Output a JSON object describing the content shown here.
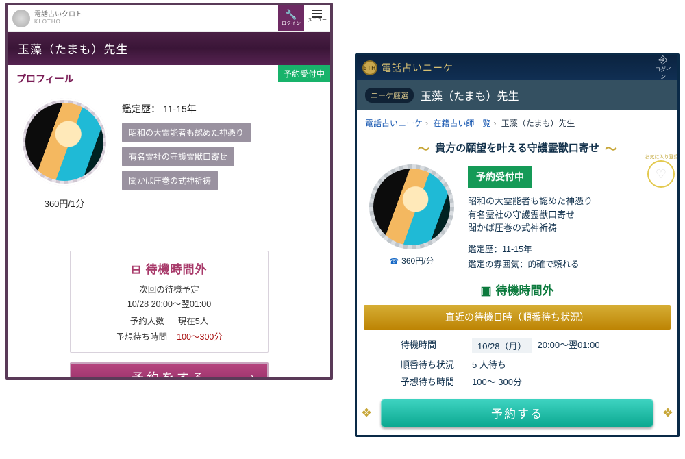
{
  "klotho": {
    "brand_top": "電話占いクロト",
    "brand_sub": "KLOTHO",
    "login_label": "ログイン",
    "menu_label": "メニュー",
    "title": "玉藻（たまも）先生",
    "section_title": "プロフィール",
    "status_badge": "予約受付中",
    "experience_label": "鑑定歴",
    "experience_value": "11-15年",
    "tags": [
      "昭和の大霊能者も認めた神憑り",
      "有名霊社の守護霊獣口寄せ",
      "聞かば圧巻の式神祈祷"
    ],
    "price": "360円/1分",
    "wait": {
      "title": "待機時間外",
      "next_label": "次回の待機予定",
      "next_value": "10/28 20:00～翌01:00",
      "count_label": "予約人数",
      "count_value": "現在5人",
      "eta_label": "予想待ち時間",
      "eta_value": "100～300分"
    },
    "reserve_label": "予約をする"
  },
  "nike": {
    "brand": "電話占いニーケ",
    "brand_badge": "5TH",
    "login_label": "ログイン",
    "name_badge": "ニーケ厳選",
    "name": "玉藻（たまも）先生",
    "crumbs": {
      "c1": "電話占いニーケ",
      "c2": "在籍占い師一覧",
      "c3": "玉藻（たまも）先生"
    },
    "tagline": "貴方の願望を叶える守護霊獣口寄せ",
    "status_badge": "予約受付中",
    "fav_label": "お気に入り登録",
    "features": [
      "昭和の大霊能者も認めた神憑り",
      "有名霊社の守護霊獣口寄せ",
      "聞かば圧巻の式神祈祷"
    ],
    "meta": {
      "exp_label": "鑑定歴",
      "exp_value": "11-15年",
      "mood_label": "鑑定の雰囲気",
      "mood_value": "的確で頼れる"
    },
    "price": "360円/分",
    "wait_title": "待機時間外",
    "band": "直近の待機日時（順番待ち状況）",
    "sched": {
      "l1_label": "待機時間",
      "l1_date": "10/28（月）",
      "l1_time": "20:00～翌01:00",
      "l2_label": "順番待ち状況",
      "l2_value": "5 人待ち",
      "l3_label": "予想待ち時間",
      "l3_value": "100～ 300分"
    },
    "reserve_label": "予約する"
  }
}
